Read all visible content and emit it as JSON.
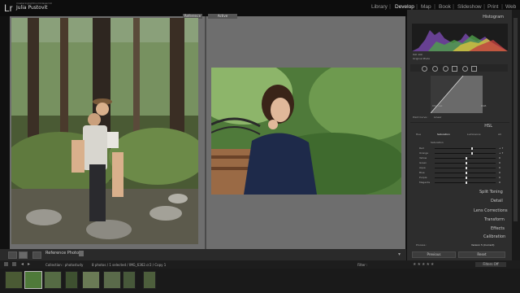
{
  "app": {
    "logo": "Lr",
    "catalog_name": "masteringlightroomClassic10",
    "user_name": "Julia Pustovit"
  },
  "modules": [
    "Library",
    "Develop",
    "Map",
    "Book",
    "Slideshow",
    "Print",
    "Web"
  ],
  "active_module": "Develop",
  "compare": {
    "reference_label": "Reference",
    "active_label": "Active"
  },
  "toolbar": {
    "reference_photo_label": "Reference Photo :"
  },
  "right_panel": {
    "histogram_title": "Histogram",
    "histogram_info": "ISO 100",
    "original_photo_label": "Original Photo",
    "point_curve_label": "Point Curve :",
    "point_curve_value": "Linear",
    "channel_label": "Channel",
    "channel_value": "RGB",
    "hsl_title": "HSL",
    "hsl_tabs": [
      "Hue",
      "Saturation",
      "Luminance",
      "All"
    ],
    "hsl_active_tab": "Saturation",
    "hsl_sub_title": "Saturation",
    "hsl_rows": [
      {
        "label": "Red",
        "value": "+ 7"
      },
      {
        "label": "Orange",
        "value": "+ 7"
      },
      {
        "label": "Yellow",
        "value": "0"
      },
      {
        "label": "Green",
        "value": "0"
      },
      {
        "label": "Aqua",
        "value": "0"
      },
      {
        "label": "Blue",
        "value": "0"
      },
      {
        "label": "Purple",
        "value": "0"
      },
      {
        "label": "Magenta",
        "value": "0"
      }
    ],
    "sections": [
      "Split Toning",
      "Detail",
      "Lens Corrections",
      "Transform",
      "Effects",
      "Calibration"
    ],
    "process_label": "Process :",
    "process_value": "Version 5 (Current)",
    "previous_button": "Previous",
    "reset_button": "Reset"
  },
  "filmstrip": {
    "collection_label": "Collection : photostudy",
    "photo_info": "8 photos / 1 selected / IMG_6362.cr2 / Copy 1",
    "filter_label": "Filter :",
    "filters_off": "Filters Off",
    "thumbnail_count": 8,
    "selected_index": 1
  },
  "colors": {
    "accent": "#e8e8e8",
    "panel_bg": "#2d2d2d",
    "compare_bg": "#6e6e6e"
  }
}
